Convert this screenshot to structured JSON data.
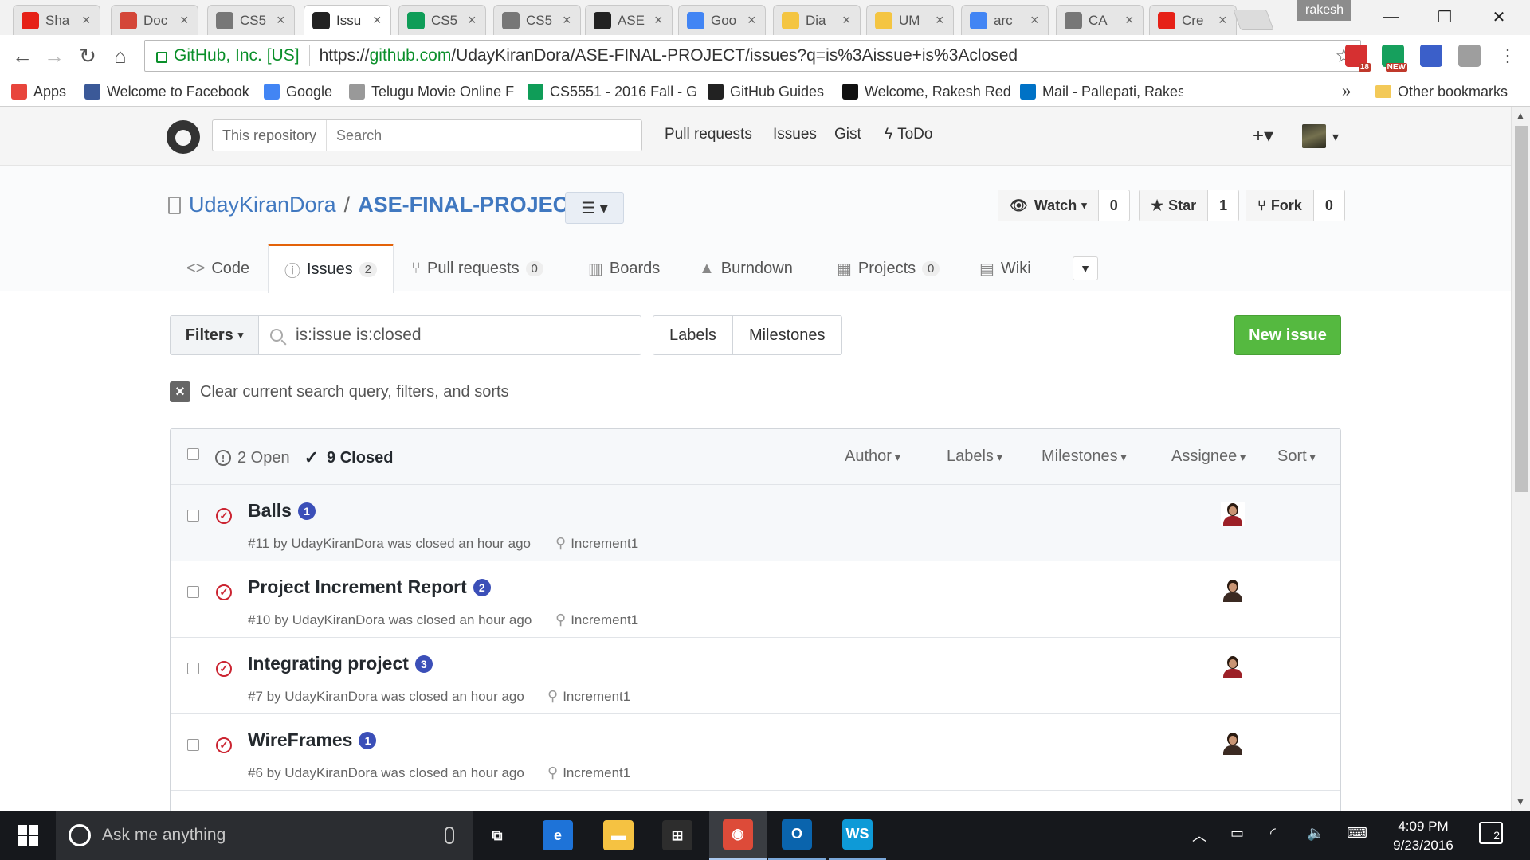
{
  "browser": {
    "tabs": [
      {
        "title": "Sha",
        "favicon": "youtube-icon",
        "color": "#e62117"
      },
      {
        "title": "Doc",
        "favicon": "gmail-icon",
        "color": "#d44638"
      },
      {
        "title": "CS5",
        "favicon": "document-icon",
        "color": "#777777"
      },
      {
        "title": "Issu",
        "favicon": "github-icon",
        "color": "#222222"
      },
      {
        "title": "CS5",
        "favicon": "sheets-icon",
        "color": "#0f9d58"
      },
      {
        "title": "CS5",
        "favicon": "document-icon",
        "color": "#777777"
      },
      {
        "title": "ASE",
        "favicon": "github-icon",
        "color": "#222222"
      },
      {
        "title": "Goo",
        "favicon": "google-icon",
        "color": "#4285f4"
      },
      {
        "title": "Dia",
        "favicon": "bulb-icon",
        "color": "#f4c542"
      },
      {
        "title": "UM",
        "favicon": "bulb-icon",
        "color": "#f4c542"
      },
      {
        "title": "arc",
        "favicon": "google-icon",
        "color": "#4285f4"
      },
      {
        "title": "CA",
        "favicon": "document-icon",
        "color": "#777777"
      },
      {
        "title": "Cre",
        "favicon": "youtube-icon",
        "color": "#e62117"
      }
    ],
    "active_tab_index": 3,
    "profile_name": "rakesh",
    "window_controls": {
      "minimize": "—",
      "restore": "❐",
      "close": "✕"
    },
    "omnibox": {
      "org": "GitHub, Inc. [US]",
      "url_prefix": "https://",
      "url_host": "github.com",
      "url_path": "/UdayKiranDora/ASE-FINAL-PROJECT/issues?q=is%3Aissue+is%3Aclosed"
    },
    "extensions": [
      {
        "name": "adblock-icon",
        "badge": "18",
        "color": "#d63031"
      },
      {
        "name": "grammarly-icon",
        "badge": "NEW",
        "color": "#16a05d"
      },
      {
        "name": "zotero-icon",
        "badge": "",
        "color": "#3b5fc9"
      },
      {
        "name": "translate-icon",
        "badge": "",
        "color": "#9e9e9e"
      }
    ],
    "bookmarks": [
      {
        "label": "Apps",
        "icon": "apps-grid-icon"
      },
      {
        "label": "Welcome to Facebook",
        "icon": "facebook-icon"
      },
      {
        "label": "Google",
        "icon": "google-icon"
      },
      {
        "label": "Telugu Movie Online F",
        "icon": "page-icon"
      },
      {
        "label": "CS5551 - 2016 Fall - G",
        "icon": "sheets-icon"
      },
      {
        "label": "GitHub Guides",
        "icon": "github-icon"
      },
      {
        "label": "Welcome, Rakesh Red",
        "icon": "blackboard-icon"
      },
      {
        "label": "Mail - Pallepati, Rakes",
        "icon": "mail-icon"
      }
    ],
    "bookmarks_overflow": "»",
    "other_bookmarks": "Other bookmarks"
  },
  "github": {
    "header": {
      "scope": "This repository",
      "search_placeholder": "Search",
      "nav": [
        "Pull requests",
        "Issues",
        "Gist",
        "ToDo"
      ],
      "plus": "+▾",
      "avatar_caret": "▾"
    },
    "repo": {
      "owner": "UdayKiranDora",
      "separator": "/",
      "name": "ASE-FINAL-PROJECT",
      "watch_label": "Watch",
      "watch_count": "0",
      "star_label": "Star",
      "star_count": "1",
      "fork_label": "Fork",
      "fork_count": "0"
    },
    "tabs": [
      {
        "label": "Code",
        "icon": "<>",
        "count": ""
      },
      {
        "label": "Issues",
        "icon": "ⓘ",
        "count": "2"
      },
      {
        "label": "Pull requests",
        "icon": "⑂",
        "count": "0"
      },
      {
        "label": "Boards",
        "icon": "▥",
        "count": ""
      },
      {
        "label": "Burndown",
        "icon": "▲",
        "count": ""
      },
      {
        "label": "Projects",
        "icon": "▦",
        "count": "0"
      },
      {
        "label": "Wiki",
        "icon": "▤",
        "count": ""
      }
    ],
    "filters": {
      "filters_label": "Filters",
      "query": "is:issue is:closed",
      "labels_btn": "Labels",
      "milestones_btn": "Milestones",
      "new_issue": "New issue",
      "clear_text": "Clear current search query, filters, and sorts"
    },
    "list_header": {
      "open_label": "2 Open",
      "closed_label": "9 Closed",
      "menus": [
        "Author",
        "Labels",
        "Milestones",
        "Assignee",
        "Sort"
      ]
    },
    "issues": [
      {
        "title": "Balls",
        "comments": "1",
        "meta": "#11 by UdayKiranDora was closed an hour ago",
        "milestone": "Increment1"
      },
      {
        "title": "Project Increment Report",
        "comments": "2",
        "meta": "#10 by UdayKiranDora was closed an hour ago",
        "milestone": "Increment1"
      },
      {
        "title": "Integrating project",
        "comments": "3",
        "meta": "#7 by UdayKiranDora was closed an hour ago",
        "milestone": "Increment1"
      },
      {
        "title": "WireFrames",
        "comments": "1",
        "meta": "#6 by UdayKiranDora was closed an hour ago",
        "milestone": "Increment1"
      }
    ]
  },
  "taskbar": {
    "search_placeholder": "Ask me anything",
    "apps": [
      {
        "name": "task-view-icon",
        "label": "⧉"
      },
      {
        "name": "edge-icon",
        "label": "e"
      },
      {
        "name": "file-explorer-icon",
        "label": "▬"
      },
      {
        "name": "store-icon",
        "label": "⊞"
      },
      {
        "name": "chrome-icon",
        "label": "◉"
      },
      {
        "name": "outlook-icon",
        "label": "O"
      },
      {
        "name": "webstorm-icon",
        "label": "WS"
      }
    ],
    "time": "4:09 PM",
    "date": "9/23/2016",
    "notifications": "2"
  }
}
